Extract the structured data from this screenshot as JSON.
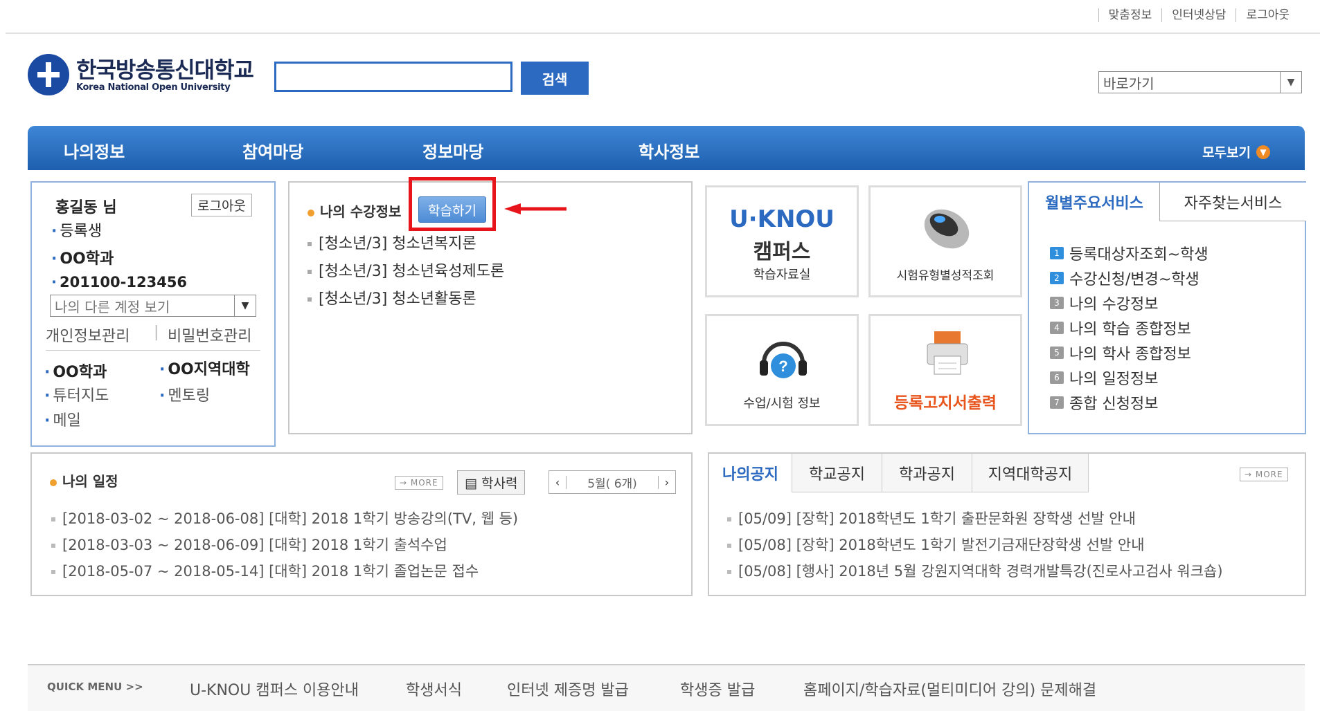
{
  "util": [
    "맞춤정보",
    "인터넷상담",
    "로그아웃"
  ],
  "logo": {
    "ko": "한국방송통신대학교",
    "en": "Korea National Open University"
  },
  "search": {
    "button": "검색",
    "value": ""
  },
  "goto": {
    "selected": "바로가기"
  },
  "nav": {
    "items": [
      "나의정보",
      "참여마당",
      "정보마당",
      "학사정보"
    ],
    "all": "모두보기"
  },
  "profile": {
    "name": "홍길동 님",
    "logout": "로그아웃",
    "status": "등록생",
    "dept": "OO학과",
    "student_id": "201100-123456",
    "account_select": "나의 다른 계정 보기",
    "privacy": "개인정보관리",
    "password": "비밀번호관리",
    "links": [
      "OO학과",
      "OO지역대학",
      "튜터지도",
      "멘토링",
      "메일"
    ]
  },
  "course": {
    "title": "나의 수강정보",
    "study_button": "학습하기",
    "items": [
      "[청소년/3] 청소년복지론",
      "[청소년/3] 청소년육성제도론",
      "[청소년/3] 청소년활동론"
    ]
  },
  "tiles": {
    "campus_logo": "U·KNOU",
    "campus_sub": "캠퍼스",
    "campus_label": "학습자료실",
    "exam_label": "시험유형별성적조회",
    "class_label": "수업/시험 정보",
    "print_label": "등록고지서출력"
  },
  "services": {
    "tabs": [
      "월별주요서비스",
      "자주찾는서비스"
    ],
    "items": [
      {
        "n": "1",
        "t": "등록대상자조회~학생"
      },
      {
        "n": "2",
        "t": "수강신청/변경~학생"
      },
      {
        "n": "3",
        "t": "나의 수강정보"
      },
      {
        "n": "4",
        "t": "나의 학습 종합정보"
      },
      {
        "n": "5",
        "t": "나의 학사 종합정보"
      },
      {
        "n": "6",
        "t": "나의 일정정보"
      },
      {
        "n": "7",
        "t": "종합 신청정보"
      }
    ]
  },
  "schedule": {
    "title": "나의 일정",
    "more": "MORE",
    "calendar": "학사력",
    "month": "5월( 6개)",
    "items": [
      "[2018-03-02 ~ 2018-06-08] [대학] 2018 1학기 방송강의(TV, 웹 등)",
      "[2018-03-03 ~ 2018-06-09] [대학] 2018 1학기 출석수업",
      "[2018-05-07 ~ 2018-05-14] [대학] 2018 1학기 졸업논문 접수"
    ]
  },
  "notice": {
    "tabs": [
      "나의공지",
      "학교공지",
      "학과공지",
      "지역대학공지"
    ],
    "more": "MORE",
    "items": [
      "[05/09] [장학] 2018학년도 1학기 출판문화원 장학생 선발 안내",
      "[05/08] [장학] 2018학년도 1학기 발전기금재단장학생 선발 안내",
      "[05/08] [행사] 2018년 5월 강원지역대학 경력개발특강(진로사고검사 워크숍)"
    ]
  },
  "footer": {
    "quick": "QUICK MENU  >>",
    "links": [
      "U-KNOU 캠퍼스 이용안내",
      "학생서식",
      "인터넷 제증명 발급",
      "학생증 발급",
      "홈페이지/학습자료(멀티미디어 강의) 문제해결"
    ]
  },
  "colors": {
    "accent": "#2b6ac0",
    "highlight": "#e8141c",
    "orange": "#f08a24"
  }
}
